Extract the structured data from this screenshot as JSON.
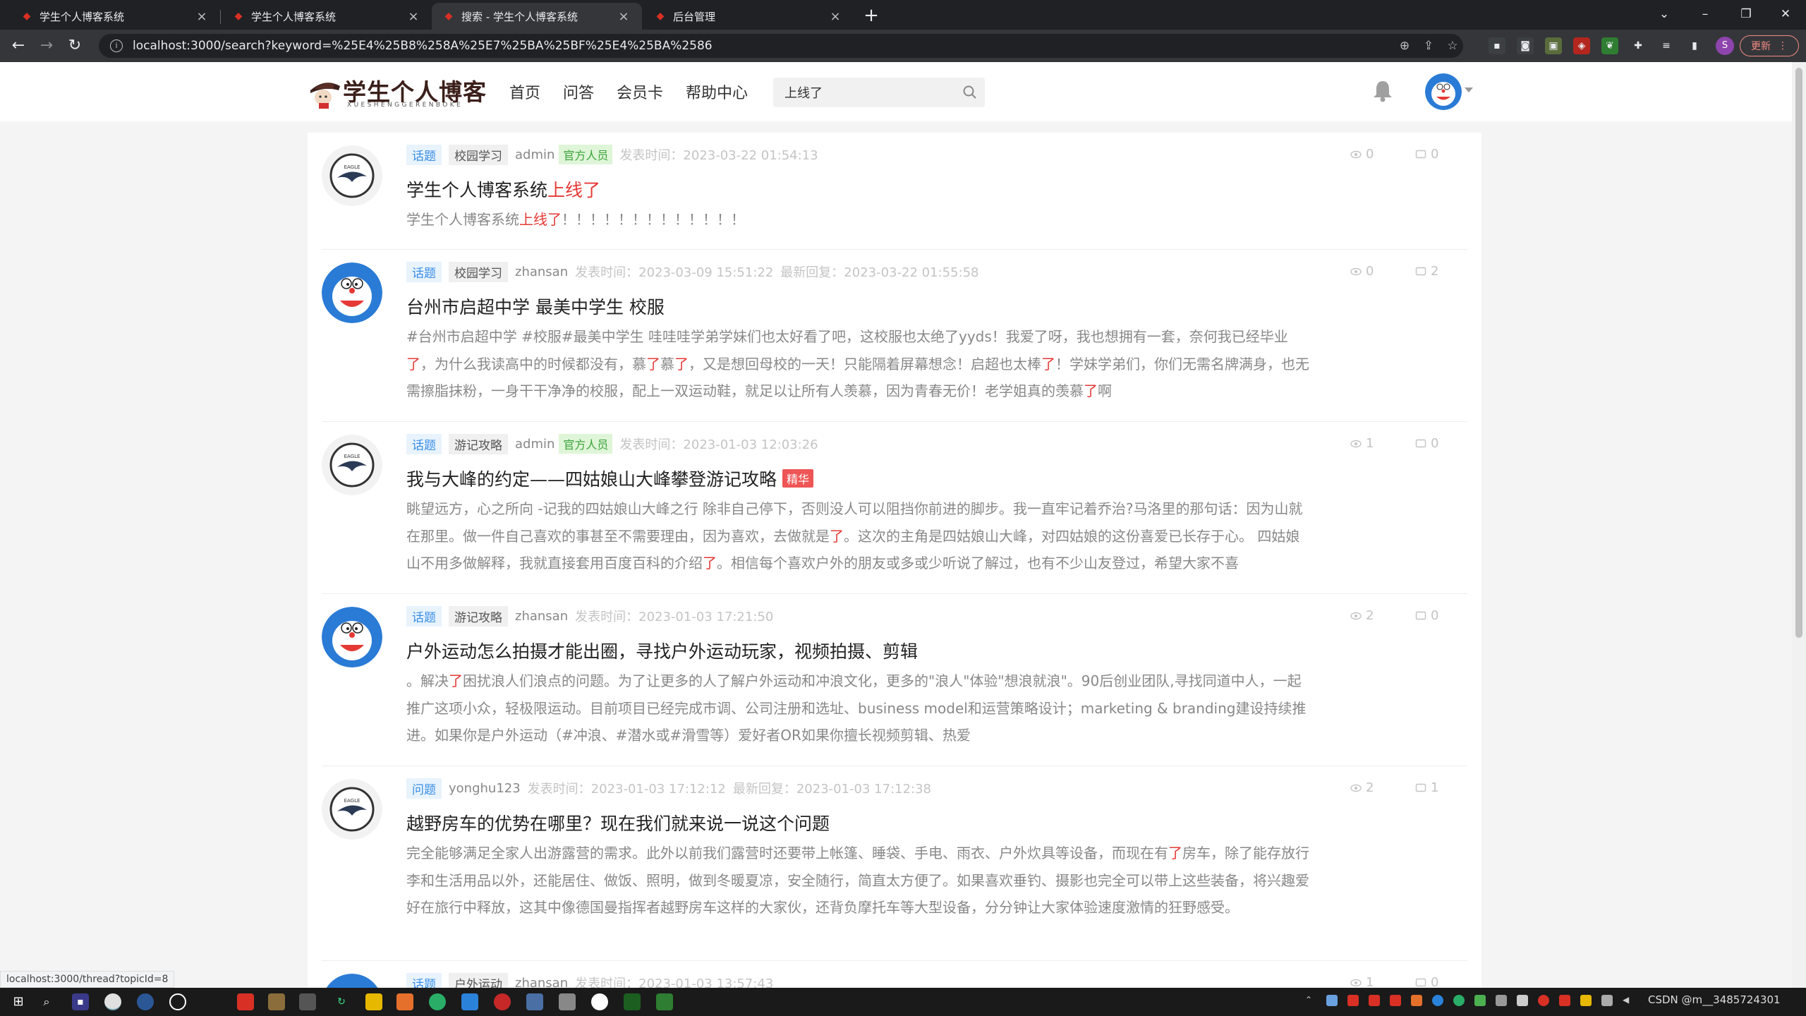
{
  "browser": {
    "tabs": [
      {
        "label": "学生个人博客系统"
      },
      {
        "label": "学生个人博客系统"
      },
      {
        "label": "搜索 - 学生个人博客系统"
      },
      {
        "label": "后台管理"
      }
    ],
    "url": "localhost:3000/search?keyword=%25E4%25B8%258A%25E7%25BA%25BF%25E4%25BA%2586",
    "update_label": "更新",
    "profile_initial": "S",
    "status_url": "localhost:3000/thread?topicId=8"
  },
  "site": {
    "logo_title": "学生个人博客",
    "logo_sub": "XUESHENGGERENBOKE",
    "nav": [
      "首页",
      "问答",
      "会员卡",
      "帮助中心"
    ],
    "search_value": "上线了"
  },
  "colors": {
    "accent_red": "#e53935",
    "topic_blue": "#3a8ee6",
    "official_green": "#3ba33b"
  },
  "posts": [
    {
      "type": "话题",
      "category": "校园学习",
      "author": "admin",
      "official": "官方人员",
      "time": "发表时间：2023-03-22 01:54:13",
      "reply": "",
      "views": "0",
      "comments": "0",
      "title_pre": "学生个人博客系统",
      "title_hl": "上线了",
      "featured": "",
      "summary": [
        {
          "t": "学生个人博客系统",
          "hl": false
        },
        {
          "t": "上线了",
          "hl": true
        },
        {
          "t": "！！！！！！！！！！！！！",
          "hl": false
        }
      ]
    },
    {
      "type": "话题",
      "category": "校园学习",
      "author": "zhansan",
      "official": "",
      "time": "发表时间：2023-03-09 15:51:22",
      "reply": "最新回复：2023-03-22 01:55:58",
      "views": "0",
      "comments": "2",
      "title_pre": "台州市启超中学 最美中学生 校服",
      "title_hl": "",
      "featured": "",
      "summary": [
        {
          "t": "#台州市启超中学 #校服#最美中学生 哇哇哇学弟学妹们也太好看了吧，这校服也太绝了yyds！我爱了呀，我也想拥有一套，奈何我已经毕业",
          "hl": false
        },
        {
          "t": "了",
          "hl": true
        },
        {
          "t": "，为什么我读高中的时候都没有，慕",
          "hl": false
        },
        {
          "t": "了",
          "hl": true
        },
        {
          "t": "慕",
          "hl": false
        },
        {
          "t": "了",
          "hl": true
        },
        {
          "t": "，又是想回母校的一天！只能隔着屏幕想念！启超也太棒",
          "hl": false
        },
        {
          "t": "了",
          "hl": true
        },
        {
          "t": "！学妹学弟们，你们无需名牌满身，也无需擦脂抹粉，一身干干净净的校服，配上一双运动鞋，就足以让所有人羡慕，因为青春无价！老学姐真的羡慕",
          "hl": false
        },
        {
          "t": "了",
          "hl": true
        },
        {
          "t": "啊",
          "hl": false
        }
      ]
    },
    {
      "type": "话题",
      "category": "游记攻略",
      "author": "admin",
      "official": "官方人员",
      "time": "发表时间：2023-01-03 12:03:26",
      "reply": "",
      "views": "1",
      "comments": "0",
      "title_pre": "我与大峰的约定——四姑娘山大峰攀登游记攻略",
      "title_hl": "",
      "featured": "精华",
      "summary": [
        {
          "t": "眺望远方，心之所向 -记我的四姑娘山大峰之行 除非自己停下，否则没人可以阻挡你前进的脚步。我一直牢记着乔治?马洛里的那句话：因为山就在那里。做一件自己喜欢的事甚至不需要理由，因为喜欢，去做就是",
          "hl": false
        },
        {
          "t": "了",
          "hl": true
        },
        {
          "t": "。这次的主角是四姑娘山大峰，对四姑娘的这份喜爱已长存于心。 四姑娘山不用多做解释，我就直接套用百度百科的介绍",
          "hl": false
        },
        {
          "t": "了",
          "hl": true
        },
        {
          "t": "。相信每个喜欢户外的朋友或多或少听说了解过，也有不少山友登过，希望大家不喜",
          "hl": false
        }
      ]
    },
    {
      "type": "话题",
      "category": "游记攻略",
      "author": "zhansan",
      "official": "",
      "time": "发表时间：2023-01-03 17:21:50",
      "reply": "",
      "views": "2",
      "comments": "0",
      "title_pre": "户外运动怎么拍摄才能出圈，寻找户外运动玩家，视频拍摄、剪辑",
      "title_hl": "",
      "featured": "",
      "summary": [
        {
          "t": "。解决",
          "hl": false
        },
        {
          "t": "了",
          "hl": true
        },
        {
          "t": "困扰浪人们浪点的问题。为了让更多的人了解户外运动和冲浪文化，更多的\"浪人\"体验\"想浪就浪\"。90后创业团队,寻找同道中人，一起推广这项小众，轻极限运动。目前项目已经完成市调、公司注册和选址、business model和运营策略设计；marketing & branding建设持续推进。如果你是户外运动（#冲浪、#潜水或#滑雪等）爱好者OR如果你擅长视频剪辑、热爱",
          "hl": false
        }
      ]
    },
    {
      "type": "问题",
      "category": "",
      "author": "yonghu123",
      "official": "",
      "time": "发表时间：2023-01-03 17:12:12",
      "reply": "最新回复：2023-01-03 17:12:38",
      "views": "2",
      "comments": "1",
      "title_pre": "越野房车的优势在哪里？现在我们就来说一说这个问题",
      "title_hl": "",
      "featured": "",
      "summary": [
        {
          "t": "完全能够满足全家人出游露营的需求。此外以前我们露营时还要带上帐篷、睡袋、手电、雨衣、户外炊具等设备，而现在有",
          "hl": false
        },
        {
          "t": "了",
          "hl": true
        },
        {
          "t": "房车，除了能存放行李和生活用品以外，还能居住、做饭、照明，做到冬暖夏凉，安全随行，简直太方便了。如果喜欢垂钓、摄影也完全可以带上这些装备，将兴趣爱好在旅行中释放，这其中像德国曼指挥者越野房车这样的大家伙，还背负摩托车等大型设备，分分钟让大家体验速度激情的狂野感受。",
          "hl": false
        }
      ]
    },
    {
      "type": "话题",
      "category": "户外运动",
      "author": "zhansan",
      "official": "",
      "time": "发表时间：2023-01-03 13:57:43",
      "reply": "",
      "views": "1",
      "comments": "0",
      "title_pre": "",
      "title_hl": "",
      "featured": "",
      "summary": []
    }
  ],
  "taskbar": {
    "clock": "CSDN @m__3485724301"
  }
}
